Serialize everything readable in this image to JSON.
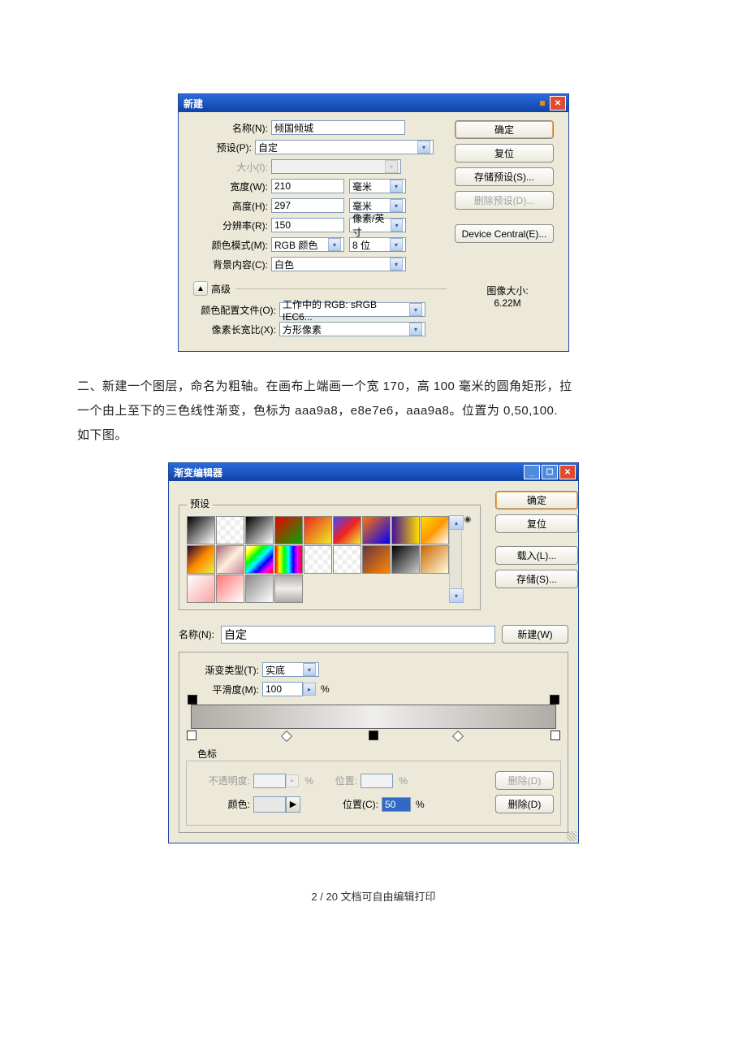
{
  "dialog_new": {
    "title": "新建",
    "labels": {
      "name": "名称(N):",
      "preset": "预设(P):",
      "size": "大小(I):",
      "width": "宽度(W):",
      "height": "高度(H):",
      "resolution": "分辨率(R):",
      "color_mode": "颜色模式(M):",
      "background": "背景内容(C):",
      "advanced": "高级",
      "color_profile": "颜色配置文件(O):",
      "pixel_aspect": "像素长宽比(X):",
      "image_size_label": "图像大小:"
    },
    "values": {
      "name": "倾国倾城",
      "preset": "自定",
      "size": "",
      "width": "210",
      "width_unit": "毫米",
      "height": "297",
      "height_unit": "毫米",
      "resolution": "150",
      "resolution_unit": "像素/英寸",
      "color_mode": "RGB 颜色",
      "bit_depth": "8 位",
      "background": "白色",
      "color_profile": "工作中的 RGB: sRGB IEC6...",
      "pixel_aspect": "方形像素",
      "image_size": "6.22M"
    },
    "buttons": {
      "ok": "确定",
      "reset": "复位",
      "save_preset": "存储预设(S)...",
      "delete_preset": "删除预设(D)...",
      "device_central": "Device Central(E)..."
    }
  },
  "paragraph": {
    "l1": "二、新建一个图层，命名为粗轴。在画布上端画一个宽 170，高 100 毫米的圆角矩形，拉",
    "l2": "一个由上至下的三色线性渐变，色标为 aaa9a8，e8e7e6，aaa9a8。位置为 0,50,100.",
    "l3": "如下图。"
  },
  "dialog_grad": {
    "title": "渐变编辑器",
    "presets_label": "预设",
    "name_label": "名称(N):",
    "name_value": "自定",
    "type_label": "渐变类型(T):",
    "type_value": "实底",
    "smooth_label": "平滑度(M):",
    "smooth_value": "100",
    "percent": "%",
    "stops_label": "色标",
    "opacity_label": "不透明度:",
    "opacity_value": "",
    "position_label": "位置:",
    "position_value": "",
    "color_label": "颜色:",
    "position_c_label": "位置(C):",
    "position_c_value": "50",
    "buttons": {
      "ok": "确定",
      "reset": "复位",
      "load": "载入(L)...",
      "save": "存储(S)...",
      "new": "新建(W)",
      "delete1": "删除(D)",
      "delete2": "删除(D)"
    }
  },
  "swatches": [
    "linear-gradient(135deg,#000,#fff)",
    "repeating-conic-gradient(#eee 0 25%,#fff 0 50%) 50%/12px 12px",
    "linear-gradient(135deg,#000,#fff)",
    "linear-gradient(135deg,#e00,#0a0)",
    "linear-gradient(135deg,#e22,#ee2)",
    "linear-gradient(135deg,#44f,#e22,#ee3)",
    "linear-gradient(135deg,#f70,#00f)",
    "linear-gradient(to right,#419,#fd0)",
    "linear-gradient(135deg,#fd0,#f90,#fff)",
    "linear-gradient(135deg,#203,#f80,#ee4)",
    "linear-gradient(135deg,#a67,#fed,#c89)",
    "linear-gradient(135deg,#fff,#ff0,#0f0,#0ff,#00f,#f0f,#f00)",
    "linear-gradient(to right,#f00,#ff0,#0f0,#0ff,#00f,#f0f,#f00)",
    "repeating-conic-gradient(#eee 0 25%,#fff 0 50%) 50%/12px 12px",
    "repeating-conic-gradient(#eee 0 25%,#fff 0 50%) 50%/12px 12px",
    "linear-gradient(135deg,#634,#f80)",
    "linear-gradient(135deg,#000,#ccc)",
    "linear-gradient(135deg,#c60,#ffd)",
    "linear-gradient(135deg,#fff,#f7a3a0)",
    "linear-gradient(135deg,#f77,#fff)",
    "linear-gradient(135deg,#888,#fff)",
    "linear-gradient(#b0aba6,#efeeed,#b0aba6)"
  ],
  "footer": "2 / 20 文档可自由编辑打印"
}
